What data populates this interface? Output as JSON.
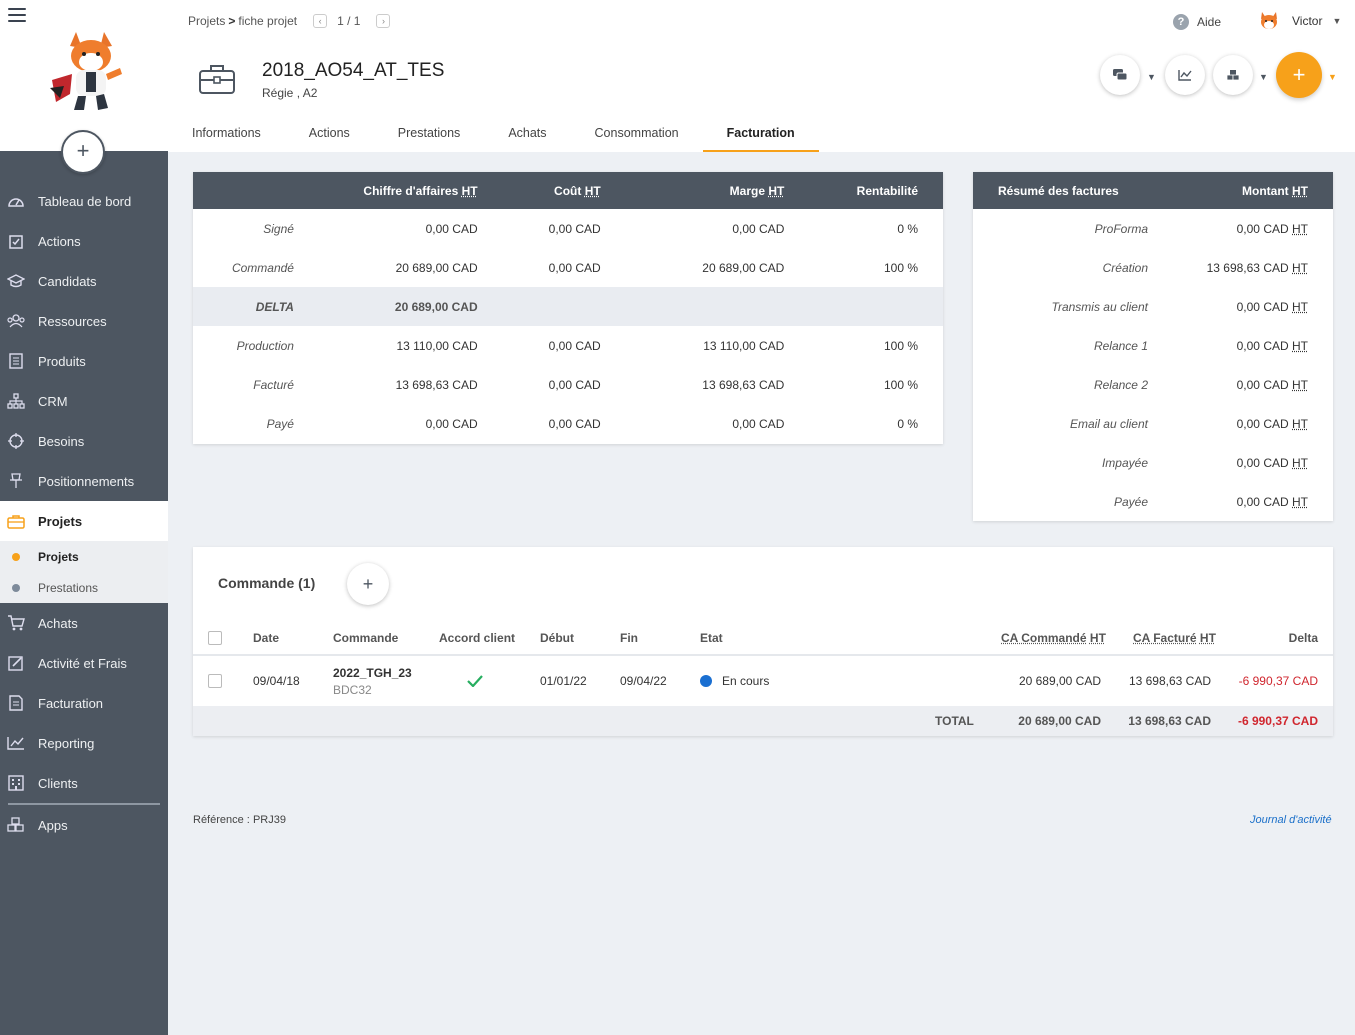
{
  "breadcrumb": {
    "parent": "Projets",
    "separator": ">",
    "current": "fiche projet",
    "page_count": "1 / 1"
  },
  "topbar": {
    "help_label": "Aide",
    "user_name": "Victor"
  },
  "project": {
    "title": "2018_AO54_AT_TES",
    "subtitle_prefix": "Régie ,",
    "subtitle_value": "A2"
  },
  "tabs": [
    "Informations",
    "Actions",
    "Prestations",
    "Achats",
    "Consommation",
    "Facturation"
  ],
  "active_tab": "Facturation",
  "sidebar": {
    "items": [
      {
        "label": "Tableau de bord",
        "icon": "dashboard-icon"
      },
      {
        "label": "Actions",
        "icon": "actions-icon"
      },
      {
        "label": "Candidats",
        "icon": "candidates-icon"
      },
      {
        "label": "Ressources",
        "icon": "resources-icon"
      },
      {
        "label": "Produits",
        "icon": "products-icon"
      },
      {
        "label": "CRM",
        "icon": "crm-icon"
      },
      {
        "label": "Besoins",
        "icon": "needs-icon"
      },
      {
        "label": "Positionnements",
        "icon": "positioning-icon"
      },
      {
        "label": "Projets",
        "icon": "briefcase-icon"
      },
      {
        "label": "Achats",
        "icon": "cart-icon"
      },
      {
        "label": "Activité et Frais",
        "icon": "activity-icon"
      },
      {
        "label": "Facturation",
        "icon": "invoice-icon"
      },
      {
        "label": "Reporting",
        "icon": "reporting-icon"
      },
      {
        "label": "Clients",
        "icon": "clients-icon"
      },
      {
        "label": "Apps",
        "icon": "apps-icon"
      }
    ],
    "sub_items": [
      "Projets",
      "Prestations"
    ]
  },
  "financial": {
    "headers": {
      "ca": "Chiffre d'affaires",
      "cout": "Coût",
      "marge": "Marge",
      "ht": "HT",
      "rentabilite": "Rentabilité"
    },
    "rows": [
      {
        "label": "Signé",
        "ca": "0,00 CAD",
        "cout": "0,00 CAD",
        "marge": "0,00 CAD",
        "rent": "0 %"
      },
      {
        "label": "Commandé",
        "ca": "20 689,00 CAD",
        "cout": "0,00 CAD",
        "marge": "20 689,00 CAD",
        "rent": "100 %"
      },
      {
        "label": "DELTA",
        "ca": "20 689,00 CAD",
        "cout": "",
        "marge": "",
        "rent": ""
      },
      {
        "label": "Production",
        "ca": "13 110,00 CAD",
        "cout": "0,00 CAD",
        "marge": "13 110,00 CAD",
        "rent": "100 %"
      },
      {
        "label": "Facturé",
        "ca": "13 698,63 CAD",
        "cout": "0,00 CAD",
        "marge": "13 698,63 CAD",
        "rent": "100 %"
      },
      {
        "label": "Payé",
        "ca": "0,00 CAD",
        "cout": "0,00 CAD",
        "marge": "0,00 CAD",
        "rent": "0 %"
      }
    ]
  },
  "summary": {
    "title": "Résumé des factures",
    "amount_header": "Montant",
    "ht": "HT",
    "rows": [
      {
        "label": "ProForma",
        "amount": "0,00 CAD"
      },
      {
        "label": "Création",
        "amount": "13 698,63 CAD"
      },
      {
        "label": "Transmis au client",
        "amount": "0,00 CAD"
      },
      {
        "label": "Relance 1",
        "amount": "0,00 CAD"
      },
      {
        "label": "Relance 2",
        "amount": "0,00 CAD"
      },
      {
        "label": "Email au client",
        "amount": "0,00 CAD"
      },
      {
        "label": "Impayée",
        "amount": "0,00 CAD"
      },
      {
        "label": "Payée",
        "amount": "0,00 CAD"
      }
    ]
  },
  "orders": {
    "title": "Commande (1)",
    "headers": {
      "date": "Date",
      "commande": "Commande",
      "accord": "Accord client",
      "debut": "Début",
      "fin": "Fin",
      "etat": "Etat",
      "ca_commande": "CA Commandé",
      "ca_facture": "CA Facturé",
      "ht": "HT",
      "delta": "Delta"
    },
    "rows": [
      {
        "date": "09/04/18",
        "commande": "2022_TGH_23",
        "ref": "BDC32",
        "debut": "01/01/22",
        "fin": "09/04/22",
        "etat": "En cours",
        "etat_color": "#1a6fd1",
        "ca_commande": "20 689,00 CAD",
        "ca_facture": "13 698,63 CAD",
        "delta": "-6 990,37 CAD"
      }
    ],
    "total": {
      "label": "TOTAL",
      "ca_commande": "20 689,00 CAD",
      "ca_facture": "13 698,63 CAD",
      "delta": "-6 990,37 CAD"
    }
  },
  "footer": {
    "reference_label": "Référence :",
    "reference_value": "PRJ39",
    "journal_link": "Journal d'activité"
  },
  "colors": {
    "accent": "#f7a11a",
    "sidebar": "#4d5661",
    "negative": "#d0262e",
    "ok": "#27ae60"
  }
}
